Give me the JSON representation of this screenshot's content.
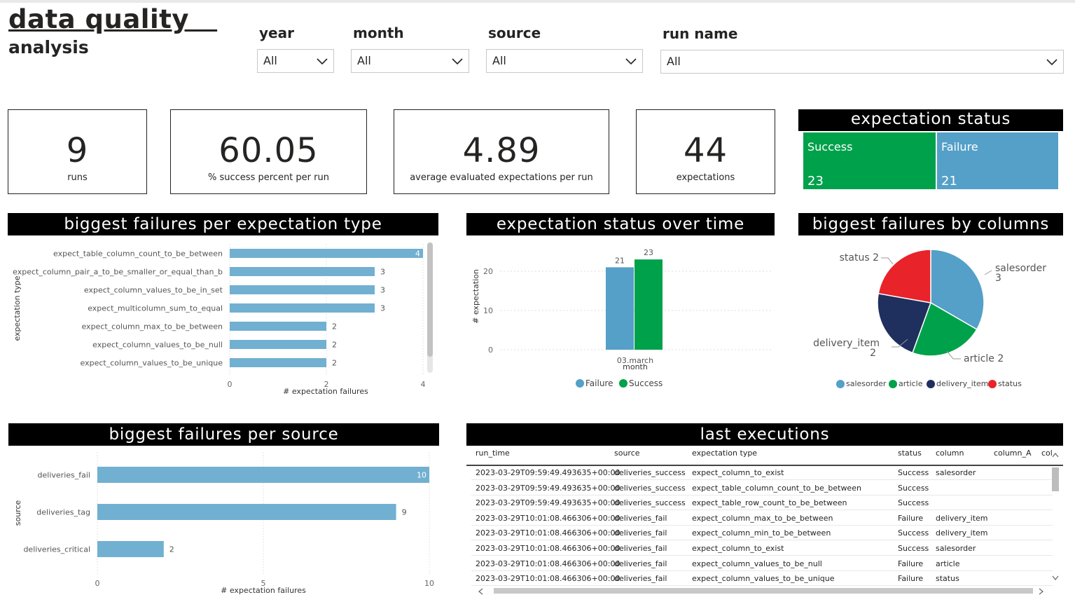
{
  "header": {
    "title_line1": "data quality   ",
    "title_line2": "analysis"
  },
  "filters": [
    {
      "label": "year",
      "value": "All"
    },
    {
      "label": "month",
      "value": "All"
    },
    {
      "label": "source",
      "value": "All"
    },
    {
      "label": "run name",
      "value": "All"
    }
  ],
  "kpis": [
    {
      "value": "9",
      "caption": "runs"
    },
    {
      "value": "60.05",
      "caption": "% success percent per run"
    },
    {
      "value": "4.89",
      "caption": "average evaluated expectations per run"
    },
    {
      "value": "44",
      "caption": "expectations"
    }
  ],
  "expectation_status": {
    "title": "expectation status",
    "tiles": [
      {
        "label": "Success",
        "value": "23",
        "color": "#00a14b"
      },
      {
        "label": "Failure",
        "value": "21",
        "color": "#54a0c8"
      }
    ]
  },
  "charts_titles": {
    "type": "biggest failures per expectation type",
    "time": "expectation status over time",
    "columns": "biggest failures by columns",
    "source": "biggest failures per source"
  },
  "chart_data": [
    {
      "type": "bar",
      "orientation": "horizontal",
      "title": "biggest failures per expectation type",
      "categories": [
        "expect_table_column_count_to_be_between",
        "expect_column_pair_a_to_be_smaller_or_equal_than_b",
        "expect_column_values_to_be_in_set",
        "expect_multicolumn_sum_to_equal",
        "expect_column_max_to_be_between",
        "expect_column_values_to_be_null",
        "expect_column_values_to_be_unique"
      ],
      "values": [
        4,
        3,
        3,
        3,
        2,
        2,
        2
      ],
      "xlabel": "# expectation failures",
      "ylabel": "expectation type",
      "xlim": [
        0,
        4
      ],
      "xticks": [
        "0",
        "2",
        "4"
      ],
      "color": "#71b0d0"
    },
    {
      "type": "bar",
      "title": "expectation status over time",
      "categories": [
        "03.march"
      ],
      "series": [
        {
          "name": "Failure",
          "values": [
            21
          ],
          "color": "#54a0c8"
        },
        {
          "name": "Success",
          "values": [
            23
          ],
          "color": "#00a14b"
        }
      ],
      "xlabel": "month",
      "ylabel": "# expectation",
      "ylim": [
        0,
        25
      ],
      "yticks": [
        "0",
        "10",
        "20"
      ],
      "legend": "bottom"
    },
    {
      "type": "pie",
      "title": "biggest failures by columns",
      "labels": [
        "salesorder",
        "article",
        "delivery_item",
        "status"
      ],
      "values": [
        3,
        2,
        2,
        2
      ],
      "colors": [
        "#54a0c8",
        "#00a14b",
        "#1f2f5e",
        "#e8232a"
      ],
      "legend": "bottom"
    },
    {
      "type": "bar",
      "orientation": "horizontal",
      "title": "biggest failures per source",
      "categories": [
        "deliveries_fail",
        "deliveries_tag",
        "deliveries_critical"
      ],
      "values": [
        10,
        9,
        2
      ],
      "xlabel": "# expectation failures",
      "ylabel": "source",
      "xlim": [
        0,
        10
      ],
      "xticks": [
        "0",
        "5",
        "10"
      ],
      "color": "#71b0d0"
    }
  ],
  "last_executions": {
    "title": "last executions",
    "columns": [
      "run_time",
      "source",
      "expectation type",
      "status",
      "column",
      "column_A",
      "col"
    ],
    "rows": [
      [
        "2023-03-29T09:59:49.493635+00:00",
        "deliveries_success",
        "expect_column_to_exist",
        "Success",
        "salesorder",
        ""
      ],
      [
        "2023-03-29T09:59:49.493635+00:00",
        "deliveries_success",
        "expect_table_column_count_to_be_between",
        "Success",
        "",
        ""
      ],
      [
        "2023-03-29T09:59:49.493635+00:00",
        "deliveries_success",
        "expect_table_row_count_to_be_between",
        "Success",
        "",
        ""
      ],
      [
        "2023-03-29T10:01:08.466306+00:00",
        "deliveries_fail",
        "expect_column_max_to_be_between",
        "Failure",
        "delivery_item",
        ""
      ],
      [
        "2023-03-29T10:01:08.466306+00:00",
        "deliveries_fail",
        "expect_column_min_to_be_between",
        "Success",
        "delivery_item",
        ""
      ],
      [
        "2023-03-29T10:01:08.466306+00:00",
        "deliveries_fail",
        "expect_column_to_exist",
        "Success",
        "salesorder",
        ""
      ],
      [
        "2023-03-29T10:01:08.466306+00:00",
        "deliveries_fail",
        "expect_column_values_to_be_null",
        "Failure",
        "article",
        ""
      ],
      [
        "2023-03-29T10:01:08.466306+00:00",
        "deliveries_fail",
        "expect_column_values_to_be_unique",
        "Failure",
        "status",
        ""
      ]
    ]
  }
}
